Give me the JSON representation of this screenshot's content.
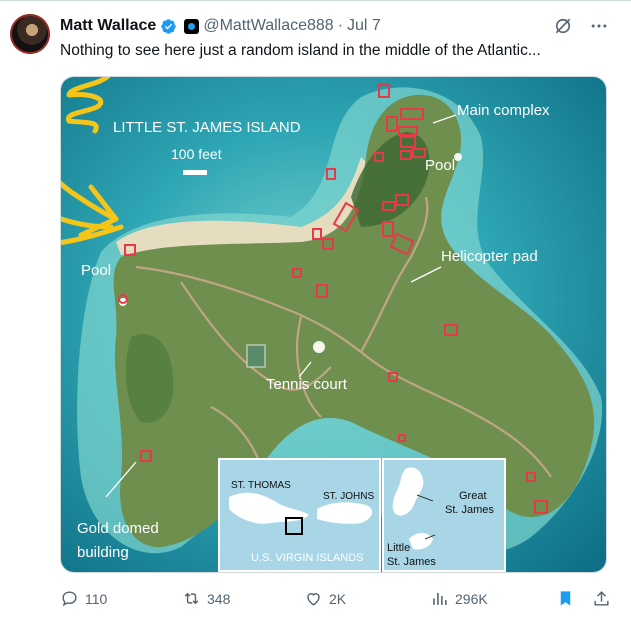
{
  "tweet": {
    "author_name": "Matt Wallace",
    "handle": "@MattWallace888",
    "separator": "·",
    "date": "Jul 7",
    "text": "Nothing to see here just a random island in the middle of the Atlantic..."
  },
  "map": {
    "title": "LITTLE ST. JAMES ISLAND",
    "scale": "100 feet",
    "labels": {
      "main_complex": "Main complex",
      "pool_top": "Pool",
      "pool_left": "Pool",
      "helicopter": "Helicopter pad",
      "tennis": "Tennis court",
      "gold_line1": "Gold domed",
      "gold_line2": "building"
    },
    "inset": {
      "st_thomas": "ST. THOMAS",
      "st_johns": "ST. JOHNS",
      "usvi": "U.S. VIRGIN ISLANDS",
      "great_line1": "Great",
      "great_line2": "St. James",
      "little_line1": "Little",
      "little_line2": "St. James"
    }
  },
  "actions": {
    "replies": "110",
    "reposts": "348",
    "likes": "2K",
    "views": "296K"
  },
  "colors": {
    "verified": "#1d9bf0",
    "bookmark": "#1d9bf0",
    "water": "#2fa7b4",
    "land": "#6f8f4e",
    "highlight_yellow": "#f5c518",
    "building_box": "#e8394a"
  }
}
